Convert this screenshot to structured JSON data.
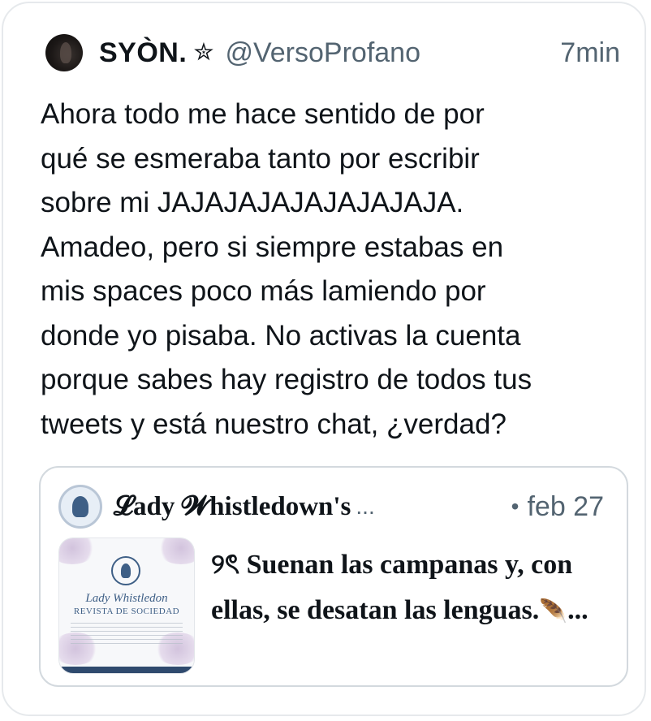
{
  "tweet": {
    "author_name": "SYÒN.",
    "badge_icon": "star-icon",
    "badge_glyph": "✮",
    "handle": "@VersoProfano",
    "time": "7min",
    "text": "Ahora todo me hace sentido de por\nqué se esmeraba tanto por escribir\nsobre mi JAJAJAJAJAJAJAJAJA.\nAmadeo, pero si siempre estabas en\nmis spaces poco más lamiendo por\ndonde yo pisaba. No activas la cuenta\nporque sabes hay registro de todos tus\ntweets y está nuestro chat, ¿verdad?"
  },
  "quote": {
    "author_name": "𝓛ady 𝓦histledown's",
    "ellipsis": "...",
    "separator": "•",
    "date": "feb 27",
    "thumbnail": {
      "title": "Lady Whistledon",
      "subtitle": "REVISTA DE SOCIEDAD"
    },
    "text_prefix": "୨ৎ",
    "text": " Suenan las campanas y, con ellas, se desatan las lenguas.",
    "feather_icon": "feather-icon",
    "feather_glyph": "🪶",
    "trailing": "..."
  }
}
